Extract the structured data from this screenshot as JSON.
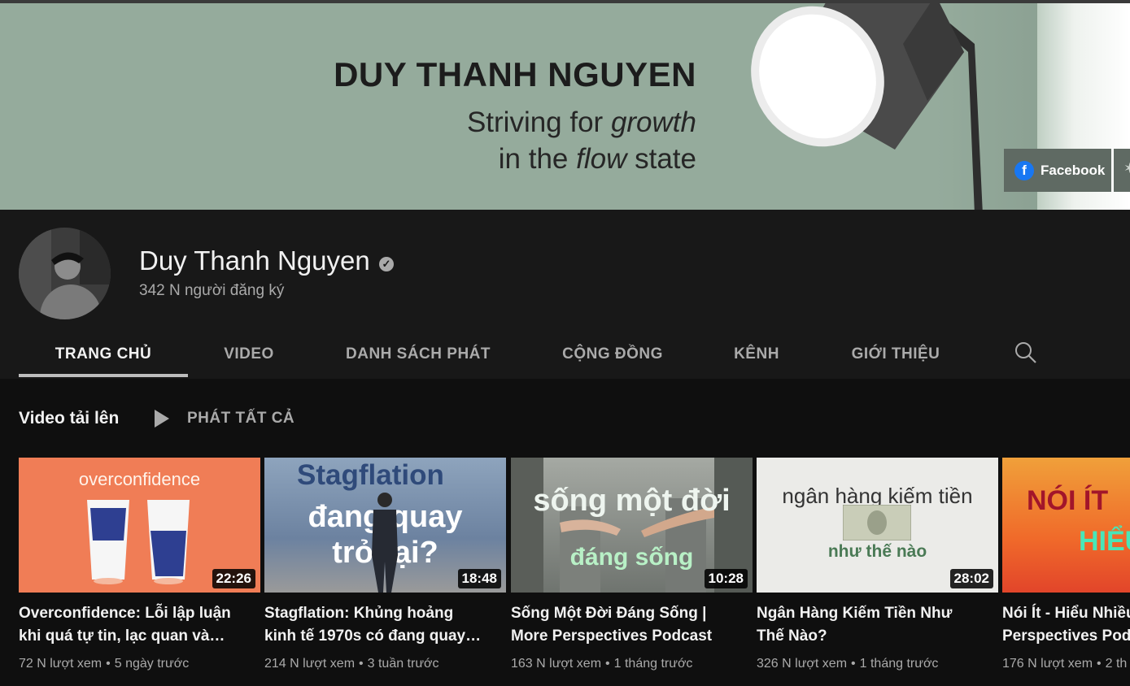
{
  "banner": {
    "title": "DUY THANH NGUYEN",
    "tagline_1a": "Striving for ",
    "tagline_1b": "growth",
    "tagline_2a": "in the ",
    "tagline_2b": "flow",
    "tagline_2c": " state",
    "links": [
      {
        "label": "Facebook",
        "icon": "facebook-icon"
      }
    ]
  },
  "channel": {
    "name": "Duy Thanh Nguyen",
    "verified_icon": "verified-check-icon",
    "subscribers": "342 N người đăng ký"
  },
  "tabs": [
    {
      "label": "TRANG CHỦ",
      "active": true
    },
    {
      "label": "VIDEO"
    },
    {
      "label": "DANH SÁCH PHÁT"
    },
    {
      "label": "CỘNG ĐỒNG"
    },
    {
      "label": "KÊNH"
    },
    {
      "label": "GIỚI THIỆU"
    }
  ],
  "section": {
    "title": "Video tải lên",
    "play_all": "PHÁT TẤT CẢ"
  },
  "videos": [
    {
      "thumb_text": [
        "overconfidence"
      ],
      "duration": "22:26",
      "title_1": "Overconfidence: Lỗi lập luận",
      "title_2": "khi quá tự tin, lạc quan và…",
      "views": "72 N lượt xem",
      "age": "5 ngày trước"
    },
    {
      "thumb_text": [
        "Stagflation",
        "đang quay",
        "trở lại?"
      ],
      "duration": "18:48",
      "title_1": "Stagflation: Khủng hoảng",
      "title_2": "kinh tế 1970s có đang quay…",
      "views": "214 N lượt xem",
      "age": "3 tuần trước"
    },
    {
      "thumb_text": [
        "sống một đời",
        "đáng sống"
      ],
      "duration": "10:28",
      "title_1": "Sống Một Đời Đáng Sống |",
      "title_2": "More Perspectives Podcast",
      "views": "163 N lượt xem",
      "age": "1 tháng trước"
    },
    {
      "thumb_text": [
        "ngân hàng kiếm tiền",
        "như thế nào"
      ],
      "duration": "28:02",
      "title_1": "Ngân Hàng Kiếm Tiền Như",
      "title_2": "Thế Nào?",
      "views": "326 N lượt xem",
      "age": "1 tháng trước"
    },
    {
      "thumb_text": [
        "NÓI ÍT",
        "HIỂU"
      ],
      "duration": "",
      "title_1": "Nói Ít - Hiểu Nhiều",
      "title_2": "Perspectives Podcast",
      "views": "176 N lượt xem",
      "age": "2 th"
    }
  ],
  "colors": {
    "background": "#0f0f0f",
    "header": "#181818",
    "banner": "#95ab9c",
    "secondary_text": "#aaaaaa"
  }
}
